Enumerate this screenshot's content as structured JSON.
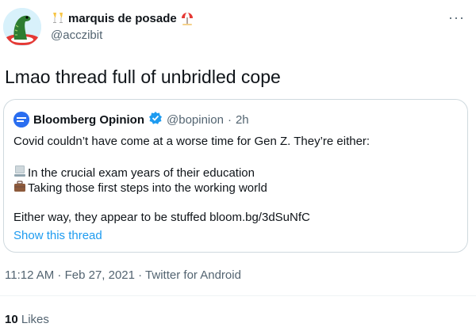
{
  "author": {
    "display_name": "marquis de posade",
    "handle": "@acczibit",
    "avatar_icon": "lizard-avatar-icon",
    "emoji_before": "champagne-emoji-icon",
    "emoji_after": "beach-umbrella-emoji-icon"
  },
  "more_icon": "···",
  "tweet_text": "Lmao thread full of unbridled cope",
  "quote": {
    "display_name": "Bloomberg Opinion",
    "handle": "@bopinion",
    "separator": "·",
    "time": "2h",
    "line1": "Covid couldn’t have come at a worse time for Gen Z. They’re either:",
    "line2": "In the crucial exam years of their education",
    "line3": "Taking those first steps into the working world",
    "line4": "Either way, they appear to be stuffed bloom.bg/3dSuNfC",
    "show_thread": "Show this thread",
    "verified_color": "#1d9bf0"
  },
  "meta": "11:12 AM · Feb 27, 2021 · Twitter for Android",
  "likes": {
    "count": "10",
    "label": "Likes"
  },
  "colors": {
    "link": "#1d9bf0",
    "secondary_text": "#536471",
    "border": "#cfd9de"
  }
}
